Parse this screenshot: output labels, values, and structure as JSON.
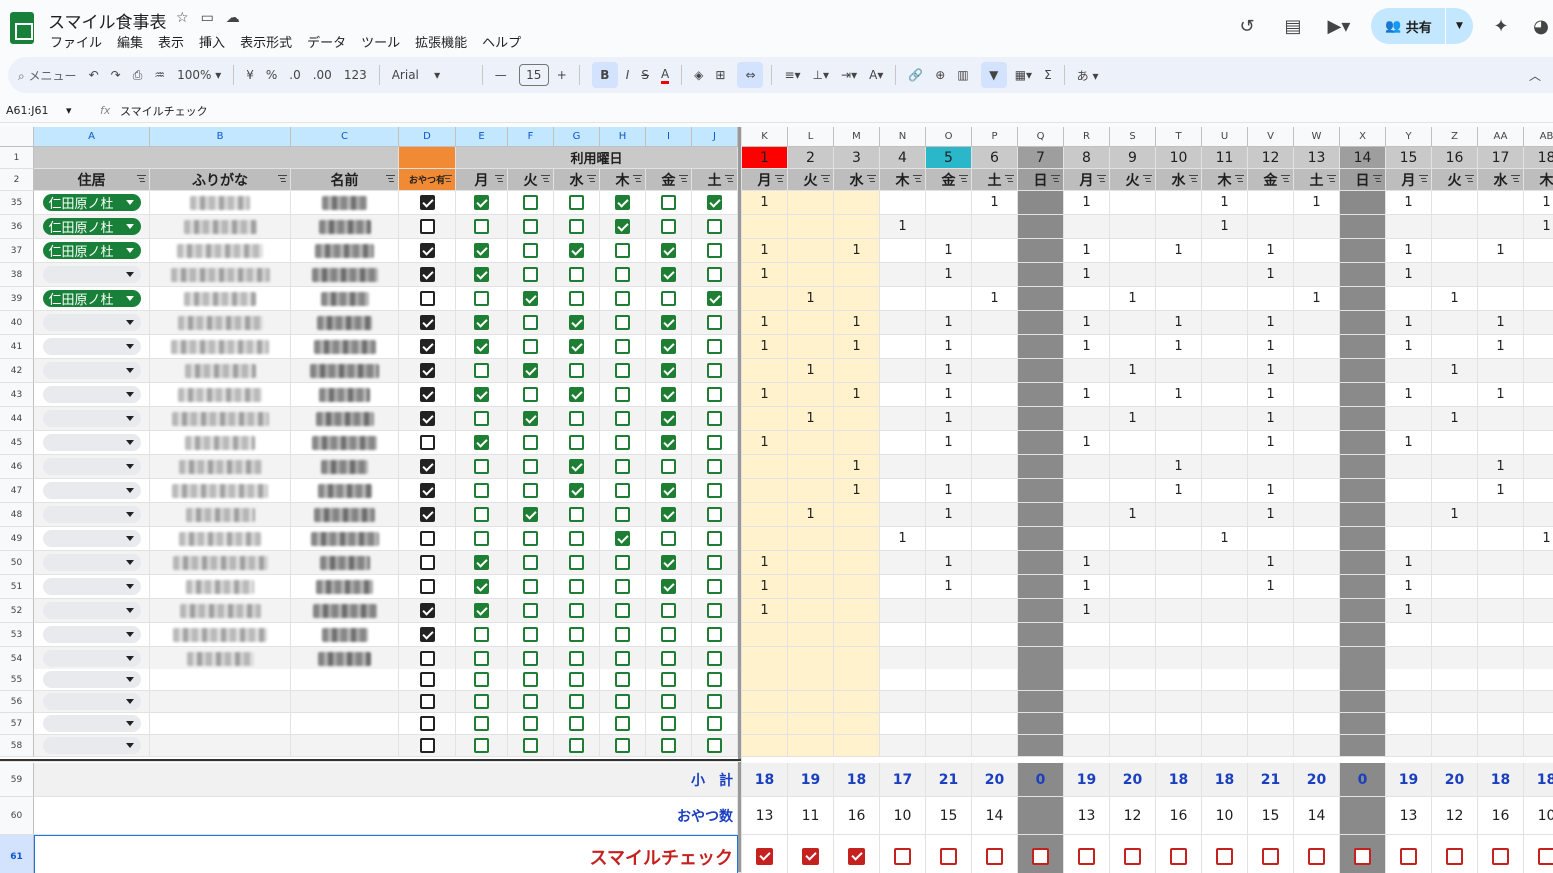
{
  "app": {
    "title": "スマイル食事表",
    "share_label": "共有"
  },
  "menu": [
    "ファイル",
    "編集",
    "表示",
    "挿入",
    "表示形式",
    "データ",
    "ツール",
    "拡張機能",
    "ヘルプ"
  ],
  "toolbar": {
    "search": "メニュー",
    "zoom": "100%",
    "currency": "¥",
    "percent": "%",
    "dec_minus": ".0",
    "dec_plus": ".00",
    "format": "123",
    "font": "Arial",
    "font_size": "15",
    "bold": "B",
    "italic": "I",
    "strike": "S",
    "textcolor": "A",
    "ime": "あ"
  },
  "formula": {
    "namebox": "A61:J61",
    "fx": "fx",
    "value": "スマイルチェック"
  },
  "columns": [
    "A",
    "B",
    "C",
    "D",
    "E",
    "F",
    "G",
    "H",
    "I",
    "J",
    "K",
    "L",
    "M",
    "N",
    "O",
    "P",
    "Q",
    "R",
    "S",
    "T",
    "U",
    "V",
    "W",
    "X",
    "Y",
    "Z",
    "AA",
    "AB"
  ],
  "header": {
    "usage_days": "利用曜日",
    "col_a": "住居",
    "col_b": "ふりがな",
    "col_c": "名前",
    "col_d": "おやつ有",
    "weekdays": [
      "月",
      "火",
      "水",
      "木",
      "金",
      "土"
    ]
  },
  "dates": [
    "1",
    "2",
    "3",
    "4",
    "5",
    "6",
    "7",
    "8",
    "9",
    "10",
    "11",
    "12",
    "13",
    "14",
    "15",
    "16",
    "17",
    "18"
  ],
  "date_days": [
    "月",
    "火",
    "水",
    "木",
    "金",
    "土",
    "日",
    "月",
    "火",
    "水",
    "木",
    "金",
    "土",
    "日",
    "月",
    "火",
    "水",
    "木"
  ],
  "rows": [
    {
      "n": "35",
      "loc": "仁田原ノ杜",
      "d": 1,
      "w": [
        1,
        0,
        0,
        1,
        0,
        1
      ],
      "v": [
        "1",
        "",
        "",
        "",
        "",
        "1",
        "",
        "1",
        "",
        "",
        "1",
        "",
        "1",
        "",
        "1",
        "",
        "",
        "1"
      ]
    },
    {
      "n": "36",
      "loc": "仁田原ノ杜",
      "d": 0,
      "w": [
        0,
        0,
        0,
        1,
        0,
        0
      ],
      "v": [
        "",
        "",
        "",
        "1",
        "",
        "",
        "",
        "",
        "",
        "",
        "1",
        "",
        "",
        "",
        "",
        "",
        "",
        "1"
      ]
    },
    {
      "n": "37",
      "loc": "仁田原ノ杜",
      "d": 1,
      "w": [
        1,
        0,
        1,
        0,
        1,
        0
      ],
      "v": [
        "1",
        "",
        "1",
        "",
        "1",
        "",
        "",
        "1",
        "",
        "1",
        "",
        "1",
        "",
        "",
        "1",
        "",
        "1",
        ""
      ]
    },
    {
      "n": "38",
      "loc": "",
      "d": 1,
      "w": [
        1,
        0,
        0,
        0,
        1,
        0
      ],
      "v": [
        "1",
        "",
        "",
        "",
        "1",
        "",
        "",
        "1",
        "",
        "",
        "",
        "1",
        "",
        "",
        "1",
        "",
        "",
        ""
      ]
    },
    {
      "n": "39",
      "loc": "仁田原ノ杜",
      "d": 0,
      "w": [
        0,
        1,
        0,
        0,
        0,
        1
      ],
      "v": [
        "",
        "1",
        "",
        "",
        "",
        "1",
        "",
        "",
        "1",
        "",
        "",
        "",
        "1",
        "",
        "",
        "1",
        "",
        ""
      ]
    },
    {
      "n": "40",
      "loc": "",
      "d": 1,
      "w": [
        1,
        0,
        1,
        0,
        1,
        0
      ],
      "v": [
        "1",
        "",
        "1",
        "",
        "1",
        "",
        "",
        "1",
        "",
        "1",
        "",
        "1",
        "",
        "",
        "1",
        "",
        "1",
        ""
      ]
    },
    {
      "n": "41",
      "loc": "",
      "d": 1,
      "w": [
        1,
        0,
        1,
        0,
        1,
        0
      ],
      "v": [
        "1",
        "",
        "1",
        "",
        "1",
        "",
        "",
        "1",
        "",
        "1",
        "",
        "1",
        "",
        "",
        "1",
        "",
        "1",
        ""
      ]
    },
    {
      "n": "42",
      "loc": "",
      "d": 1,
      "w": [
        0,
        1,
        0,
        0,
        1,
        0
      ],
      "v": [
        "",
        "1",
        "",
        "",
        "1",
        "",
        "",
        "",
        "1",
        "",
        "",
        "1",
        "",
        "",
        "",
        "1",
        "",
        ""
      ]
    },
    {
      "n": "43",
      "loc": "",
      "d": 1,
      "w": [
        1,
        0,
        1,
        0,
        1,
        0
      ],
      "v": [
        "1",
        "",
        "1",
        "",
        "1",
        "",
        "",
        "1",
        "",
        "1",
        "",
        "1",
        "",
        "",
        "1",
        "",
        "1",
        ""
      ]
    },
    {
      "n": "44",
      "loc": "",
      "d": 1,
      "w": [
        0,
        1,
        0,
        0,
        1,
        0
      ],
      "v": [
        "",
        "1",
        "",
        "",
        "1",
        "",
        "",
        "",
        "1",
        "",
        "",
        "1",
        "",
        "",
        "",
        "1",
        "",
        ""
      ]
    },
    {
      "n": "45",
      "loc": "",
      "d": 0,
      "w": [
        1,
        0,
        0,
        0,
        1,
        0
      ],
      "v": [
        "1",
        "",
        "",
        "",
        "1",
        "",
        "",
        "1",
        "",
        "",
        "",
        "1",
        "",
        "",
        "1",
        "",
        "",
        ""
      ]
    },
    {
      "n": "46",
      "loc": "",
      "d": 1,
      "w": [
        0,
        0,
        1,
        0,
        0,
        0
      ],
      "v": [
        "",
        "",
        "1",
        "",
        "",
        "",
        "",
        "",
        "",
        "1",
        "",
        "",
        "",
        "",
        "",
        "",
        "1",
        ""
      ]
    },
    {
      "n": "47",
      "loc": "",
      "d": 1,
      "w": [
        0,
        0,
        1,
        0,
        1,
        0
      ],
      "v": [
        "",
        "",
        "1",
        "",
        "1",
        "",
        "",
        "",
        "",
        "1",
        "",
        "1",
        "",
        "",
        "",
        "",
        "1",
        ""
      ]
    },
    {
      "n": "48",
      "loc": "",
      "d": 1,
      "w": [
        0,
        1,
        0,
        0,
        1,
        0
      ],
      "v": [
        "",
        "1",
        "",
        "",
        "1",
        "",
        "",
        "",
        "1",
        "",
        "",
        "1",
        "",
        "",
        "",
        "1",
        "",
        ""
      ]
    },
    {
      "n": "49",
      "loc": "",
      "d": 0,
      "w": [
        0,
        0,
        0,
        1,
        0,
        0
      ],
      "v": [
        "",
        "",
        "",
        "1",
        "",
        "",
        "",
        "",
        "",
        "",
        "1",
        "",
        "",
        "",
        "",
        "",
        "",
        "1"
      ]
    },
    {
      "n": "50",
      "loc": "",
      "d": 0,
      "w": [
        1,
        0,
        0,
        0,
        1,
        0
      ],
      "v": [
        "1",
        "",
        "",
        "",
        "1",
        "",
        "",
        "1",
        "",
        "",
        "",
        "1",
        "",
        "",
        "1",
        "",
        "",
        ""
      ]
    },
    {
      "n": "51",
      "loc": "",
      "d": 0,
      "w": [
        1,
        0,
        0,
        0,
        1,
        0
      ],
      "v": [
        "1",
        "",
        "",
        "",
        "1",
        "",
        "",
        "1",
        "",
        "",
        "",
        "1",
        "",
        "",
        "1",
        "",
        "",
        ""
      ]
    },
    {
      "n": "52",
      "loc": "",
      "d": 1,
      "w": [
        1,
        0,
        0,
        0,
        0,
        0
      ],
      "v": [
        "1",
        "",
        "",
        "",
        "",
        "",
        "",
        "1",
        "",
        "",
        "",
        "",
        "",
        "",
        "1",
        "",
        "",
        ""
      ]
    },
    {
      "n": "53",
      "loc": "",
      "d": 1,
      "w": [
        0,
        0,
        0,
        0,
        0,
        0
      ],
      "v": [
        "",
        "",
        "",
        "",
        "",
        "",
        "",
        "",
        "",
        "",
        "",
        "",
        "",
        "",
        "",
        "",
        "",
        ""
      ]
    },
    {
      "n": "54",
      "loc": "",
      "d": 0,
      "w": [
        0,
        0,
        0,
        0,
        0,
        0
      ],
      "v": [
        "",
        "",
        "",
        "",
        "",
        "",
        "",
        "",
        "",
        "",
        "",
        "",
        "",
        "",
        "",
        "",
        "",
        ""
      ]
    },
    {
      "n": "55",
      "loc": "",
      "d": 0,
      "w": [
        0,
        0,
        0,
        0,
        0,
        0
      ],
      "v": [
        "",
        "",
        "",
        "",
        "",
        "",
        "",
        "",
        "",
        "",
        "",
        "",
        "",
        "",
        "",
        "",
        "",
        ""
      ]
    },
    {
      "n": "56",
      "loc": "",
      "d": 0,
      "w": [
        0,
        0,
        0,
        0,
        0,
        0
      ],
      "v": [
        "",
        "",
        "",
        "",
        "",
        "",
        "",
        "",
        "",
        "",
        "",
        "",
        "",
        "",
        "",
        "",
        "",
        ""
      ]
    },
    {
      "n": "57",
      "loc": "",
      "d": 0,
      "w": [
        0,
        0,
        0,
        0,
        0,
        0
      ],
      "v": [
        "",
        "",
        "",
        "",
        "",
        "",
        "",
        "",
        "",
        "",
        "",
        "",
        "",
        "",
        "",
        "",
        "",
        ""
      ]
    },
    {
      "n": "58",
      "loc": "",
      "d": 0,
      "w": [
        0,
        0,
        0,
        0,
        0,
        0
      ],
      "v": [
        "",
        "",
        "",
        "",
        "",
        "",
        "",
        "",
        "",
        "",
        "",
        "",
        "",
        "",
        "",
        "",
        "",
        ""
      ]
    }
  ],
  "summary": {
    "subtotal_label": "小　計",
    "subtotal": [
      "18",
      "19",
      "18",
      "17",
      "21",
      "20",
      "0",
      "19",
      "20",
      "18",
      "18",
      "21",
      "20",
      "0",
      "19",
      "20",
      "18",
      "18"
    ],
    "snack_label": "おやつ数",
    "snack": [
      "13",
      "11",
      "16",
      "10",
      "15",
      "14",
      "",
      "13",
      "12",
      "16",
      "10",
      "15",
      "14",
      "",
      "13",
      "12",
      "16",
      "10"
    ],
    "smile_label": "スマイルチェック",
    "smile": [
      1,
      1,
      1,
      0,
      0,
      0,
      0,
      0,
      0,
      0,
      0,
      0,
      0,
      0,
      0,
      0,
      0,
      0
    ]
  },
  "colors": {
    "red_date": "#ff0000",
    "teal_date": "#2ab7c9",
    "orange": "#f08a34",
    "green": "#188038",
    "sunday": "#8a8a8a",
    "yellow": "#fff2cc"
  }
}
